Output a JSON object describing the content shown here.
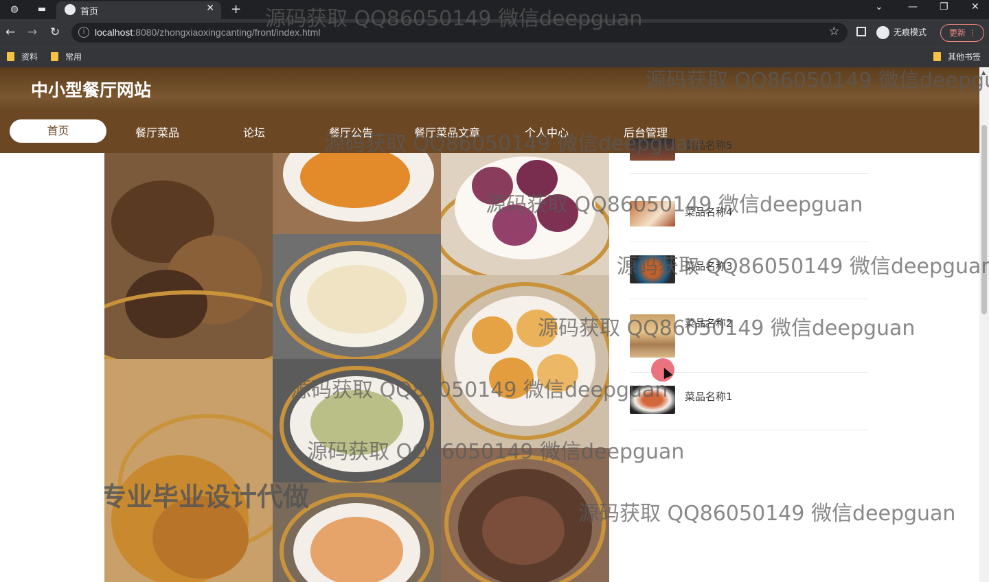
{
  "browser": {
    "tab_title": "首页",
    "url_host": "localhost",
    "url_rest": ":8080/zhongxiaoxingcanting/front/index.html",
    "incognito_label": "无痕模式",
    "update_label": "更新",
    "bookmarks": [
      "资料",
      "常用"
    ],
    "other_bookmarks": "其他书签"
  },
  "site": {
    "title": "中小型餐厅网站",
    "nav": [
      "首页",
      "餐厅菜品",
      "论坛",
      "餐厅公告",
      "餐厅菜品文章",
      "个人中心",
      "后台管理"
    ]
  },
  "banner": {
    "overlay_text": "专业毕业设计代做"
  },
  "news": [
    {
      "title": "菜品名称5"
    },
    {
      "title": "菜品名称4"
    },
    {
      "title": "菜品名称3"
    },
    {
      "title": "菜品名称2"
    },
    {
      "title": "菜品名称1"
    }
  ],
  "watermark": "源码获取 QQ86050149 微信deepguan",
  "colors": {
    "header": "#6b4724",
    "accent": "#fff"
  }
}
